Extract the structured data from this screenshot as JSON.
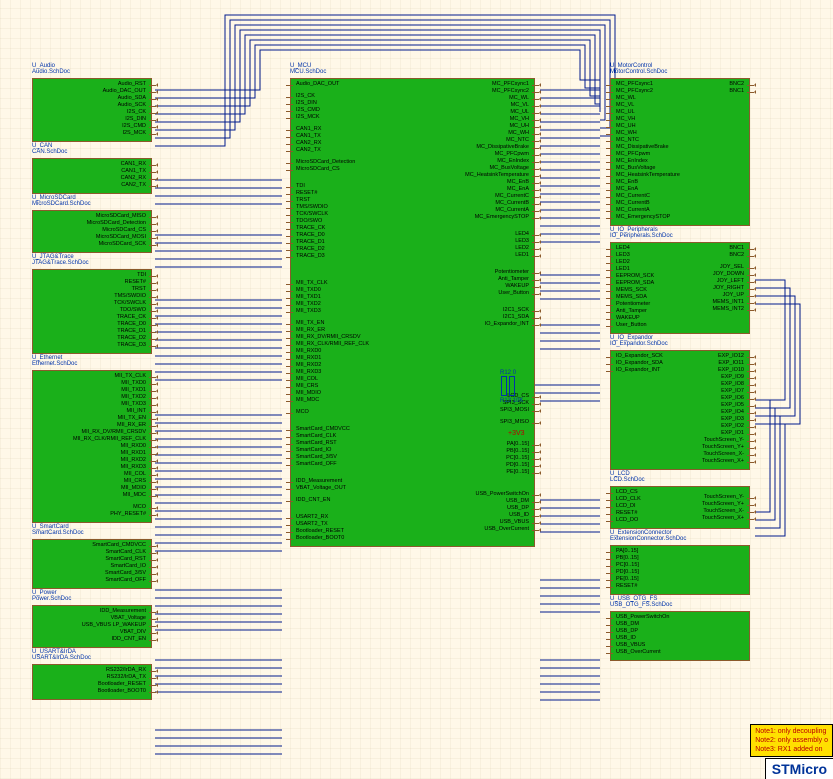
{
  "notes": {
    "line1": "Note1: only decoupling",
    "line2": "Note2: only assembly o",
    "line3": "Note3: RX1 added on"
  },
  "titleblock": "STMicro",
  "power": {
    "rail": "+3V3"
  },
  "resistors": {
    "r12": "R12",
    "r13": "R13",
    "val": "10K",
    "zero": "0"
  },
  "left_blocks": [
    {
      "name": "U_Audio",
      "doc": "Audio.SchDoc",
      "pins_r": [
        "Audio_RST",
        "Audio_DAC_OUT",
        "Audio_SDA",
        "Audio_SCK",
        "I2S_CK",
        "I2S_DIN",
        "I2S_CMD",
        "I2S_MCK"
      ]
    },
    {
      "name": "U_CAN",
      "doc": "CAN.SchDoc",
      "pins_r": [
        "CAN1_RX",
        "CAN1_TX",
        "CAN2_RX",
        "CAN2_TX"
      ]
    },
    {
      "name": "U_MicroSDCard",
      "doc": "MicroSDCard.SchDoc",
      "pins_r": [
        "MicroSDCard_MISO",
        "MicroSDCard_Detection",
        "MicroSDCard_CS",
        "MicroSDCard_MOSI",
        "MicroSDCard_SCK"
      ]
    },
    {
      "name": "U_JTAG&Trace",
      "doc": "JTAG&Trace.SchDoc",
      "pins_r": [
        "TDI",
        "RESET#",
        "TRST",
        "TMS/SWDIO",
        "TCK/SWCLK",
        "TDO/SWO",
        "TRACE_CK",
        "TRACE_D0",
        "TRACE_D1",
        "TRACE_D2",
        "TRACE_D3"
      ]
    },
    {
      "name": "U_Ethernet",
      "doc": "Ethernet.SchDoc",
      "pins_r": [
        "MII_TX_CLK",
        "MII_TXD0",
        "MII_TXD1",
        "MII_TXD2",
        "MII_TXD3",
        "MII_INT",
        "MII_TX_EN",
        "MII_RX_ER",
        "MII_RX_DV/RMII_CRSDV",
        "MII_RX_CLK/RMII_REF_CLK",
        "MII_RXD0",
        "MII_RXD1",
        "MII_RXD2",
        "MII_RXD3",
        "MII_COL",
        "MII_CRS",
        "MII_MDIO",
        "MII_MDC",
        "",
        "MCO",
        "PHY_RESET#"
      ]
    },
    {
      "name": "U_SmartCard",
      "doc": "SmartCard.SchDoc",
      "pins_r": [
        "SmartCard_CMDVCC",
        "SmartCard_CLK",
        "SmartCard_RST",
        "SmartCard_IO",
        "SmartCard_3/5V",
        "SmartCard_OFF"
      ]
    },
    {
      "name": "U_Power",
      "doc": "Power.SchDoc",
      "pins_r": [
        "IDD_Measurement",
        "VBAT_Voltage",
        "USB_VBUS    LP_WAKEUP",
        "VBAT_DIV",
        "IDD_CNT_EN"
      ]
    },
    {
      "name": "U_USART&IrDA",
      "doc": "USART&IrDA.SchDoc",
      "pins_r": [
        "RS232/IrDA_RX",
        "RS232/IrDA_TX",
        "Bootloader_RESET",
        "Bootloader_BOOT0"
      ]
    }
  ],
  "mid_block": {
    "name": "U_MCU",
    "doc": "MCU.SchDoc",
    "pins_l": [
      "Audio_DAC_OUT",
      "",
      "I2S_CK",
      "I2S_DIN",
      "I2S_CMD",
      "I2S_MCK",
      "",
      "CAN1_RX",
      "CAN1_TX",
      "CAN2_RX",
      "CAN2_TX",
      "",
      "MicroSDCard_Detection",
      "MicroSDCard_CS",
      "",
      "",
      "TDI",
      "RESET#",
      "TRST",
      "TMS/SWDIO",
      "TCK/SWCLK",
      "TDO/SWO",
      "TRACE_CK",
      "TRACE_D0",
      "TRACE_D1",
      "TRACE_D2",
      "TRACE_D3",
      "",
      "",
      "",
      "",
      "MII_TX_CLK",
      "MII_TXD0",
      "MII_TXD1",
      "MII_TXD2",
      "MII_TXD3",
      "",
      "MII_TX_EN",
      "MII_RX_ER",
      "MII_RX_DV/RMII_CRSDV",
      "MII_RX_CLK/RMII_REF_CLK",
      "MII_RXD0",
      "MII_RXD1",
      "MII_RXD2",
      "MII_RXD3",
      "MII_COL",
      "MII_CRS",
      "MII_MDIO",
      "MII_MDC",
      "",
      "MCO",
      "",
      "",
      "SmartCard_CMDVCC",
      "SmartCard_CLK",
      "SmartCard_RST",
      "SmartCard_IO",
      "SmartCard_3/5V",
      "SmartCard_OFF",
      "",
      "",
      "IDD_Measurement",
      "VBAT_Voltage_OUT",
      "",
      "IDD_CNT_EN",
      "",
      "",
      "USART2_RX",
      "USART2_TX",
      "Bootloader_RESET",
      "Bootloader_BOOT0"
    ],
    "pins_r": [
      "MC_PFCsync1",
      "MC_PFCsync2",
      "MC_WL",
      "MC_VL",
      "MC_UL",
      "MC_VH",
      "MC_UH",
      "MC_WH",
      "MC_NTC",
      "MC_DissipativeBrake",
      "MC_PFCpwm",
      "MC_EnIndex",
      "MC_BusVoltage",
      "MC_HeatsinkTemperature",
      "MC_EnB",
      "MC_EnA",
      "MC_CurrentC",
      "MC_CurrentB",
      "MC_CurrentA",
      "MC_EmergencySTOP",
      "",
      "",
      "LED4",
      "LED3",
      "LED2",
      "LED1",
      "",
      "",
      "Potentiometer",
      "Anti_Tamper",
      "WAKEUP",
      "User_Button",
      "",
      "",
      "I2C1_SCK",
      "I2C1_SDA",
      "IO_Expandor_INT",
      "",
      "",
      "",
      "",
      "",
      "",
      "",
      "",
      "",
      "",
      "",
      "",
      "",
      "LCD_CS",
      "SPI3_SCK",
      "SPI3_MOSI",
      "",
      "SPI3_MISO",
      "",
      "",
      "",
      "PA[0..15]",
      "PB[0..15]",
      "PC[0..15]",
      "PD[0..15]",
      "PE[0..15]",
      "",
      "",
      "",
      "USB_PowerSwitchOn",
      "USB_DM",
      "USB_DP",
      "USB_ID",
      "USB_VBUS",
      "USB_OverCurrent"
    ]
  },
  "right_blocks": [
    {
      "name": "U_MotorControl",
      "doc": "MotorControl.SchDoc",
      "pins_l": [
        "MC_PFCsync1",
        "MC_PFCsync2",
        "MC_WL",
        "MC_VL",
        "MC_UL",
        "MC_VH",
        "MC_UH",
        "MC_WH",
        "MC_NTC",
        "MC_DissipativeBrake",
        "MC_PFCpwm",
        "MC_EnIndex",
        "MC_BusVoltage",
        "MC_HeatsinkTemperature",
        "MC_EnB",
        "MC_EnA",
        "MC_CurrentC",
        "MC_CurrentB",
        "MC_CurrentA",
        "MC_EmergencySTOP"
      ],
      "pins_r": [
        "BNC2",
        "BNC1"
      ]
    },
    {
      "name": "U_IO_Peripherals",
      "doc": "IO_Peripherals.SchDoc",
      "pins_l": [
        "LED4",
        "LED3",
        "LED2",
        "LED1",
        "EEPROM_SCK",
        "EEPROM_SDA",
        "MEMS_SCK",
        "MEMS_SDA",
        "Potentiometer",
        "Anti_Tamper",
        "WAKEUP",
        "User_Button"
      ],
      "pins_r": [
        "BNC1",
        "BNC2",
        "",
        "JOY_SEL",
        "JOY_DOWN",
        "JOY_LEFT",
        "JOY_RIGHT",
        "JOY_UP",
        "MEMS_INT1",
        "MEMS_INT2"
      ]
    },
    {
      "name": "U_IO_Expandor",
      "doc": "IO_Expandor.SchDoc",
      "pins_l": [
        "IO_Expandor_SCK",
        "IO_Expandor_SDA",
        "IO_Expandor_INT"
      ],
      "pins_r": [
        "EXP_IO12",
        "EXP_IO11",
        "EXP_IO10",
        "EXP_IO9",
        "EXP_IO8",
        "EXP_IO7",
        "EXP_IO6",
        "EXP_IO5",
        "EXP_IO4",
        "EXP_IO3",
        "EXP_IO2",
        "EXP_IO1",
        "TouchScreen_Y-",
        "TouchScreen_Y+",
        "TouchScreen_X-",
        "TouchScreen_X+"
      ]
    },
    {
      "name": "U_LCD",
      "doc": "LCD.SchDoc",
      "pins_l": [
        "LCD_CS",
        "LCD_CLK",
        "LCD_DI",
        "RESET#",
        "LCD_DO"
      ],
      "pins_r": [
        "",
        "TouchScreen_Y-",
        "TouchScreen_Y+",
        "TouchScreen_X-",
        "TouchScreen_X+"
      ]
    },
    {
      "name": "U_ExtensionConnector",
      "doc": "ExtensionConnector.SchDoc",
      "pins_l": [
        "PA[0..15]",
        "PB[0..15]",
        "PC[0..15]",
        "PD[0..15]",
        "PE[0..15]",
        "RESET#"
      ]
    },
    {
      "name": "U_USB_OTG_FS",
      "doc": "USB_OTG_FS.SchDoc",
      "pins_l": [
        "USB_PowerSwitchOn",
        "USB_DM",
        "USB_DP",
        "USB_ID",
        "USB_VBUS",
        "USB_OverCurrent"
      ]
    }
  ]
}
